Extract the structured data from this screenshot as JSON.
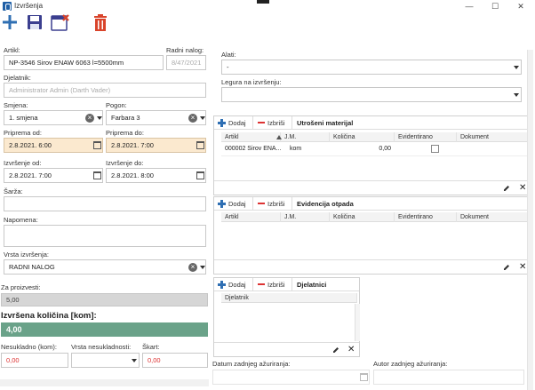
{
  "window": {
    "title": "Izvršenja",
    "min": "—",
    "max": "☐",
    "close": "✕"
  },
  "colors": {
    "accent": "#2f6fb3",
    "delete": "#d9442b",
    "peach": "#fbe9cf",
    "qty": "#6aa289"
  },
  "toolbar": {
    "icons": [
      "plus-icon",
      "save-icon",
      "save-close-icon",
      "trash-icon"
    ]
  },
  "form": {
    "artikl_label": "Artikl:",
    "artikl_value": "NP-3546 Sirov ENAW 6063 l=5500mm",
    "radni_nalog_label": "Radni nalog:",
    "radni_nalog_value": "8/47/2021",
    "djelatnik_label": "Djelatnik:",
    "djelatnik_value": "Administrator Admin (Darth Vader)",
    "smjena_label": "Smjena:",
    "smjena_value": "1. smjena",
    "pogon_label": "Pogon:",
    "pogon_value": "Farbara 3",
    "priprema_od_label": "Priprema od:",
    "priprema_od_value": "2.8.2021. 6:00",
    "priprema_do_label": "Priprema do:",
    "priprema_do_value": "2.8.2021. 7:00",
    "izvrsenje_od_label": "Izvršenje od:",
    "izvrsenje_od_value": "2.8.2021. 7:00",
    "izvrsenje_do_label": "Izvršenje do:",
    "izvrsenje_do_value": "2.8.2021. 8:00",
    "sarza_label": "Šarža:",
    "napomena_label": "Napomena:",
    "vrsta_label": "Vrsta izvršenja:",
    "vrsta_value": "RADNI NALOG",
    "za_proizvesti_label": "Za proizvesti:",
    "za_proizvesti_value": "5,00",
    "izvrsena_label": "Izvršena količina [kom]:",
    "izvrsena_value": "4,00",
    "nesukladno_label": "Nesukladno (kom):",
    "nesukladno_value": "0,00",
    "vrsta_nesukladnosti_label": "Vrsta nesukladnosti:",
    "skart_label": "Škart:",
    "skart_value": "0,00"
  },
  "right": {
    "alati_label": "Alati:",
    "alati_value": "-",
    "legura_label": "Legura na izvršenju:"
  },
  "utroseni": {
    "add": "Dodaj",
    "remove": "Izbriši",
    "title": "Utrošeni materijal",
    "cols": [
      "Artikl",
      "J.M.",
      "Količina",
      "Evidentirano",
      "Dokument"
    ],
    "rows": [
      {
        "artikl": "000002 Sirov ENA...",
        "jm": "kom",
        "kolicina": "0,00"
      }
    ]
  },
  "otpad": {
    "add": "Dodaj",
    "remove": "Izbriši",
    "title": "Evidencija otpada",
    "cols": [
      "Artikl",
      "J.M.",
      "Količina",
      "Evidentirano",
      "Dokument"
    ]
  },
  "djelatnici": {
    "add": "Dodaj",
    "remove": "Izbriši",
    "title": "Djelatnici",
    "cols": [
      "Djelatnik"
    ]
  },
  "footer": {
    "datum_label": "Datum zadnjeg ažuriranja:",
    "autor_label": "Autor zadnjeg ažuriranja:"
  }
}
